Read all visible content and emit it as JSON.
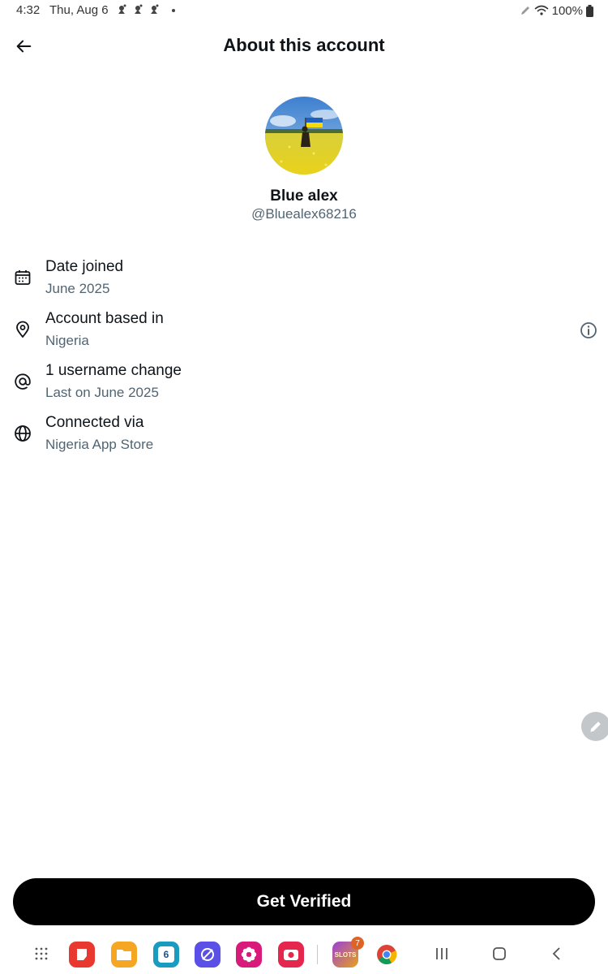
{
  "status_bar": {
    "time": "4:32",
    "date": "Thu, Aug 6",
    "notification_icons": [
      "app-notification-icon",
      "app-notification-icon",
      "app-notification-icon",
      "more-dot"
    ],
    "battery_percent": "100%"
  },
  "header": {
    "title": "About this account",
    "back_icon": "arrow-left-icon"
  },
  "profile": {
    "display_name": "Blue alex",
    "handle": "@Bluealex68216"
  },
  "info_rows": [
    {
      "icon": "calendar-icon",
      "title": "Date joined",
      "subtitle": "June 2025"
    },
    {
      "icon": "location-pin-icon",
      "title": "Account based in",
      "subtitle": "Nigeria"
    },
    {
      "icon": "at-sign-icon",
      "title": "1 username change",
      "subtitle": "Last on June 2025"
    },
    {
      "icon": "globe-icon",
      "title": "Connected via",
      "subtitle": "Nigeria App Store"
    }
  ],
  "cta": {
    "label": "Get Verified"
  },
  "dock": {
    "calendar_day": "6",
    "slots_badge": "7",
    "slots_label": "SLOTS"
  },
  "colors": {
    "text_primary": "#0f1419",
    "text_secondary": "#536471",
    "cta_background": "#000000",
    "cta_text": "#ffffff"
  }
}
